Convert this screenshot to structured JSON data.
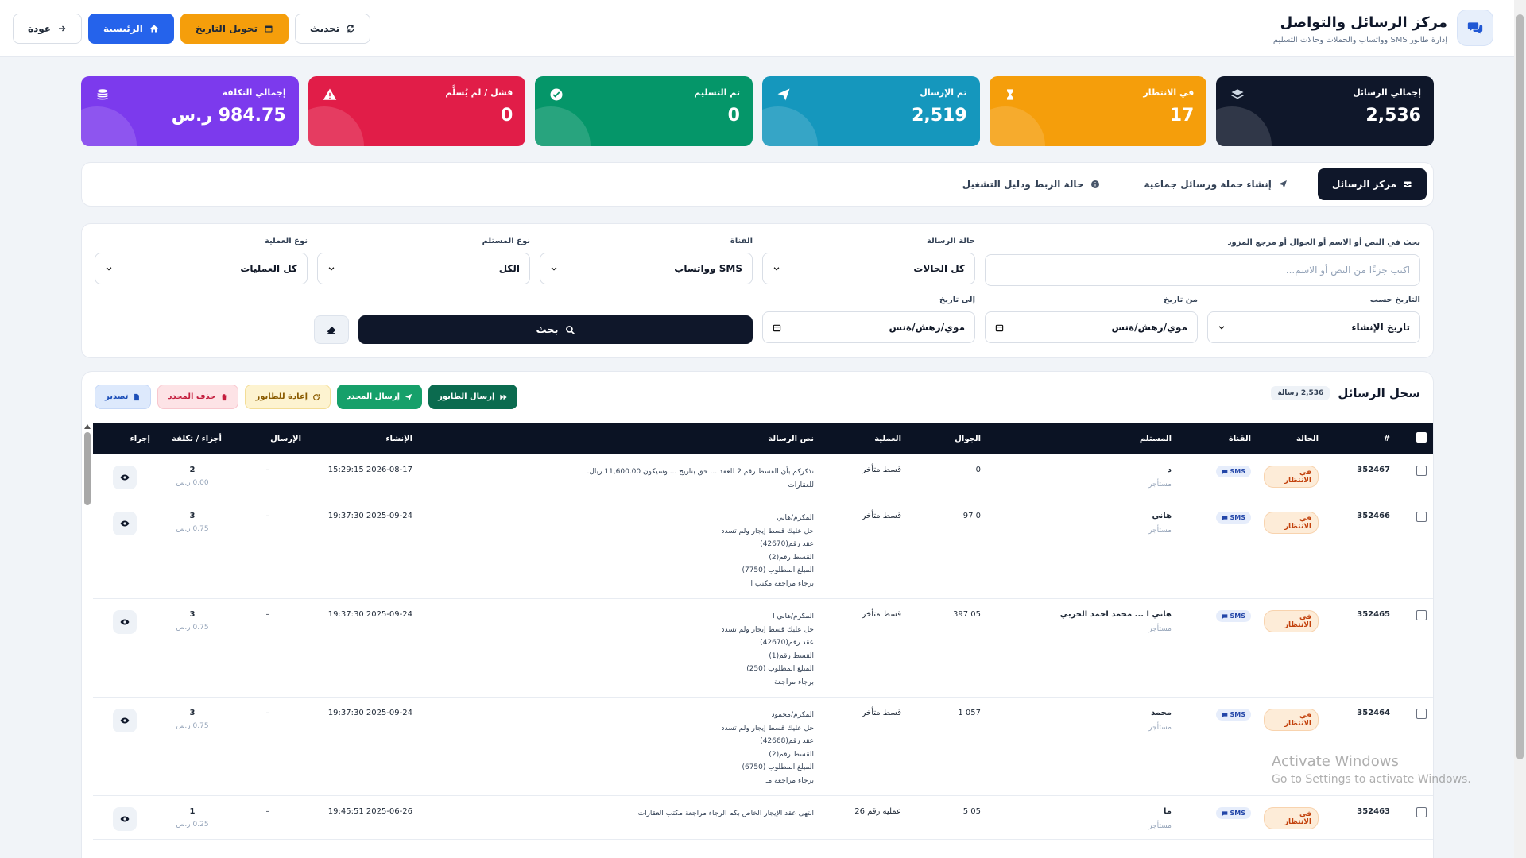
{
  "header": {
    "title": "مركز الرسائل والتواصل",
    "subtitle": "إدارة طابور SMS وواتساب والحملات وحالات التسليم",
    "buttons": {
      "back": "عودة",
      "home": "الرئيسية",
      "convert_date": "تحويل التاريخ",
      "refresh": "تحديث"
    }
  },
  "stats": [
    {
      "label": "إجمالي الرسائل",
      "value": "2,536",
      "color": "#0f172a",
      "icon": "layers-icon"
    },
    {
      "label": "في الانتظار",
      "value": "17",
      "color": "#f59e0b",
      "icon": "hourglass-icon"
    },
    {
      "label": "تم الإرسال",
      "value": "2,519",
      "color": "#1597bd",
      "icon": "paper-plane-icon"
    },
    {
      "label": "تم التسليم",
      "value": "0",
      "color": "#059669",
      "icon": "check-circle-icon"
    },
    {
      "label": "فشل / لم يُسلَّم",
      "value": "0",
      "color": "#e11d48",
      "icon": "warning-icon"
    },
    {
      "label": "إجمالي التكلفة",
      "value": "984.75 ر.س",
      "color": "#7c3aed",
      "icon": "coins-icon"
    }
  ],
  "tabs": [
    "مركز الرسائل",
    "إنشاء حملة ورسائل جماعية",
    "حالة الربط ودليل التشغيل"
  ],
  "filters": {
    "search_label": "بحث في النص أو الاسم أو الجوال أو مرجع المزود",
    "search_placeholder": "اكتب جزءًا من النص أو الاسم...",
    "status_label": "حالة الرسالة",
    "status_value": "كل الحالات",
    "channel_label": "القناة",
    "channel_value": "SMS وواتساب",
    "recipient_type_label": "نوع المستلم",
    "recipient_type_value": "الكل",
    "operation_type_label": "نوع العملية",
    "operation_type_value": "كل العمليات",
    "date_by_label": "التاريخ حسب",
    "date_by_value": "تاريخ الإنشاء",
    "from_label": "من تاريخ",
    "from_value": "موي/رهش/ةنس",
    "to_label": "إلى تاريخ",
    "to_value": "موي/رهش/ةنس",
    "search_button": "بحث"
  },
  "log": {
    "title": "سجل الرسائل",
    "count": "2,536 رسالة",
    "actions": {
      "send_queue": "إرسال الطابور",
      "send_selected": "إرسال المحدد",
      "requeue": "إعادة للطابور",
      "delete_selected": "حذف المحدد",
      "export": "تصدير"
    },
    "columns": {
      "num": "#",
      "status": "الحالة",
      "channel": "القناة",
      "recipient": "المستلم",
      "mobile": "الجوال",
      "operation": "العملية",
      "text": "نص الرسالة",
      "created": "الإنشاء",
      "sent": "الإرسال",
      "parts_cost": "أجزاء / تكلفة",
      "action": "إجراء"
    },
    "rows": [
      {
        "id": "352467",
        "status": "في الانتظار",
        "channel": "SMS",
        "name": "د",
        "type": "مستأجر",
        "mobile": "0",
        "operation": "قسط متأخر",
        "text": "نذكركم بأن القسط رقم 2 للعقد ... حق بتاريخ ... وسيكون 11,600.00 ريال.\nللعقارات",
        "created": "2026-08-17 15:29:15",
        "sent": "–",
        "parts": "2",
        "cost": "0.00 ر.س"
      },
      {
        "id": "352466",
        "status": "في الانتظار",
        "channel": "SMS",
        "name": "هاني",
        "type": "مستأجر",
        "mobile": "0 97",
        "operation": "قسط متأخر",
        "text": "المكرم/هاني\nحل عليك قسط إيجار ولم تسدد\nعقد رقم(42670)\nالقسط رقم(2)\nالمبلغ المطلوب (7750)\nبرجاء مراجعة مكتب ا",
        "created": "2025-09-24 19:37:30",
        "sent": "–",
        "parts": "3",
        "cost": "0.75 ر.س"
      },
      {
        "id": "352465",
        "status": "في الانتظار",
        "channel": "SMS",
        "name": "هاني ا ... محمد احمد الحربي",
        "type": "مستأجر",
        "mobile": "05 397",
        "operation": "قسط متأخر",
        "text": "المكرم/هاني ا\nحل عليك قسط إيجار ولم تسدد\nعقد رقم(42670)\nالقسط رقم(1)\nالمبلغ المطلوب (250)\nبرجاء مراجعة",
        "created": "2025-09-24 19:37:30",
        "sent": "–",
        "parts": "3",
        "cost": "0.75 ر.س"
      },
      {
        "id": "352464",
        "status": "في الانتظار",
        "channel": "SMS",
        "name": "محمد",
        "type": "مستأجر",
        "mobile": "057 1",
        "operation": "قسط متأخر",
        "text": "المكرم/محمود\nحل عليك قسط إيجار ولم تسدد\nعقد رقم(42668)\nالقسط رقم(2)\nالمبلغ المطلوب (6750)\nبرجاء مراجعة مـ",
        "created": "2025-09-24 19:37:30",
        "sent": "–",
        "parts": "3",
        "cost": "0.75 ر.س"
      },
      {
        "id": "352463",
        "status": "في الانتظار",
        "channel": "SMS",
        "name": "ما",
        "type": "مستأجر",
        "mobile": "05 5",
        "operation": "عملية رقم 26",
        "text": "انتهى عقد الإيجار الخاص بكم الرجاء مراجعة مكتب العقارات",
        "created": "2025-06-26 19:45:51",
        "sent": "–",
        "parts": "1",
        "cost": "0.25 ر.س"
      }
    ]
  },
  "watermark": {
    "line1": "Activate Windows",
    "line2": "Go to Settings to activate Windows."
  }
}
